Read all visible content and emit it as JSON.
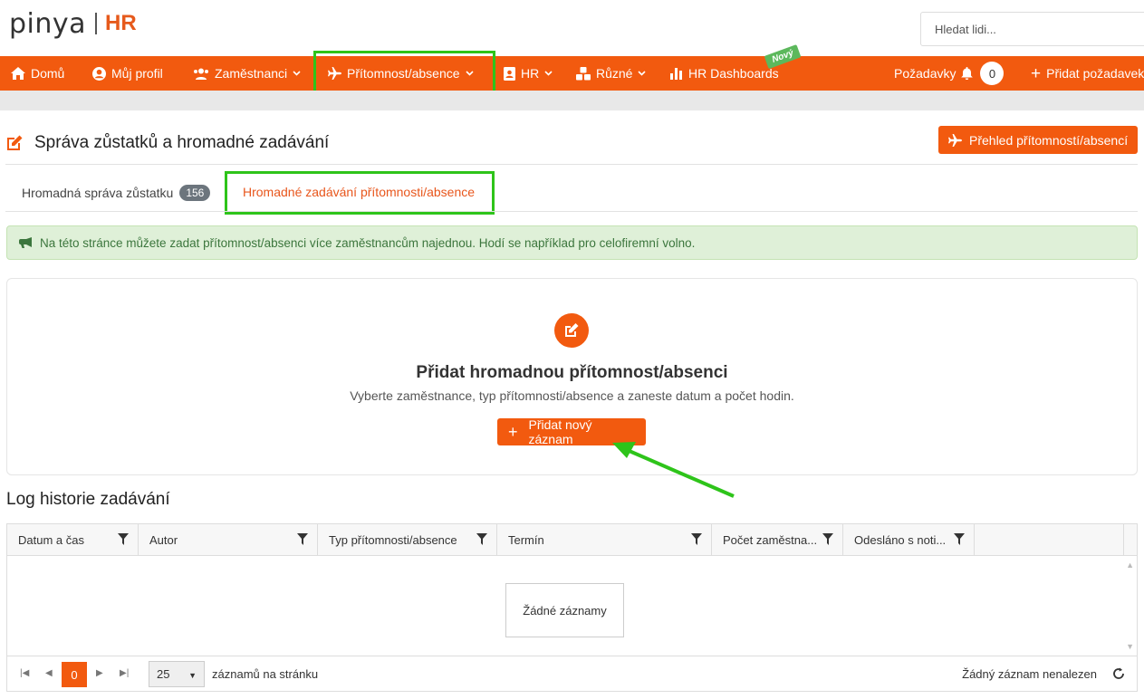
{
  "header": {
    "logo_text": "pinya",
    "logo_suffix": "HR",
    "search_placeholder": "Hledat lidi..."
  },
  "nav": {
    "items": [
      {
        "label": "Domů"
      },
      {
        "label": "Můj profil"
      },
      {
        "label": "Zaměstnanci"
      },
      {
        "label": "Přítomnost/absence"
      },
      {
        "label": "HR"
      },
      {
        "label": "Různé"
      },
      {
        "label": "HR Dashboards"
      }
    ],
    "new_badge": "Nový",
    "requests_label": "Požadavky",
    "requests_count": "0",
    "add_request_label": "Přidat požadavek"
  },
  "page": {
    "title": "Správa zůstatků a hromadné zadávání",
    "overview_button": "Přehled přítomností/absencí",
    "tabs": [
      {
        "label": "Hromadná správa zůstatku",
        "count": "156"
      },
      {
        "label": "Hromadné zadávání přítomnosti/absence"
      }
    ],
    "alert": "Na této stránce můžete zadat přítomnost/absenci více zaměstnancům najednou. Hodí se například pro celofiremní volno."
  },
  "card": {
    "title": "Přidat hromadnou přítomnost/absenci",
    "subtitle": "Vyberte zaměstnance, typ přítomnosti/absence a zaneste datum a počet hodin.",
    "button": "Přidat nový záznam"
  },
  "log": {
    "title": "Log historie zadávání",
    "columns": [
      {
        "label": "Datum a čas"
      },
      {
        "label": "Autor"
      },
      {
        "label": "Typ přítomnosti/absence"
      },
      {
        "label": "Termín"
      },
      {
        "label": "Počet zaměstna..."
      },
      {
        "label": "Odesláno s noti..."
      }
    ],
    "empty": "Žádné záznamy",
    "current_page": "0",
    "page_size": "25",
    "page_size_label": "záznamů na stránku",
    "info": "Žádný záznam nenalezen"
  },
  "colors": {
    "accent": "#f25a0f",
    "highlight": "#2ec41a",
    "alert_bg": "#dff0d8"
  }
}
